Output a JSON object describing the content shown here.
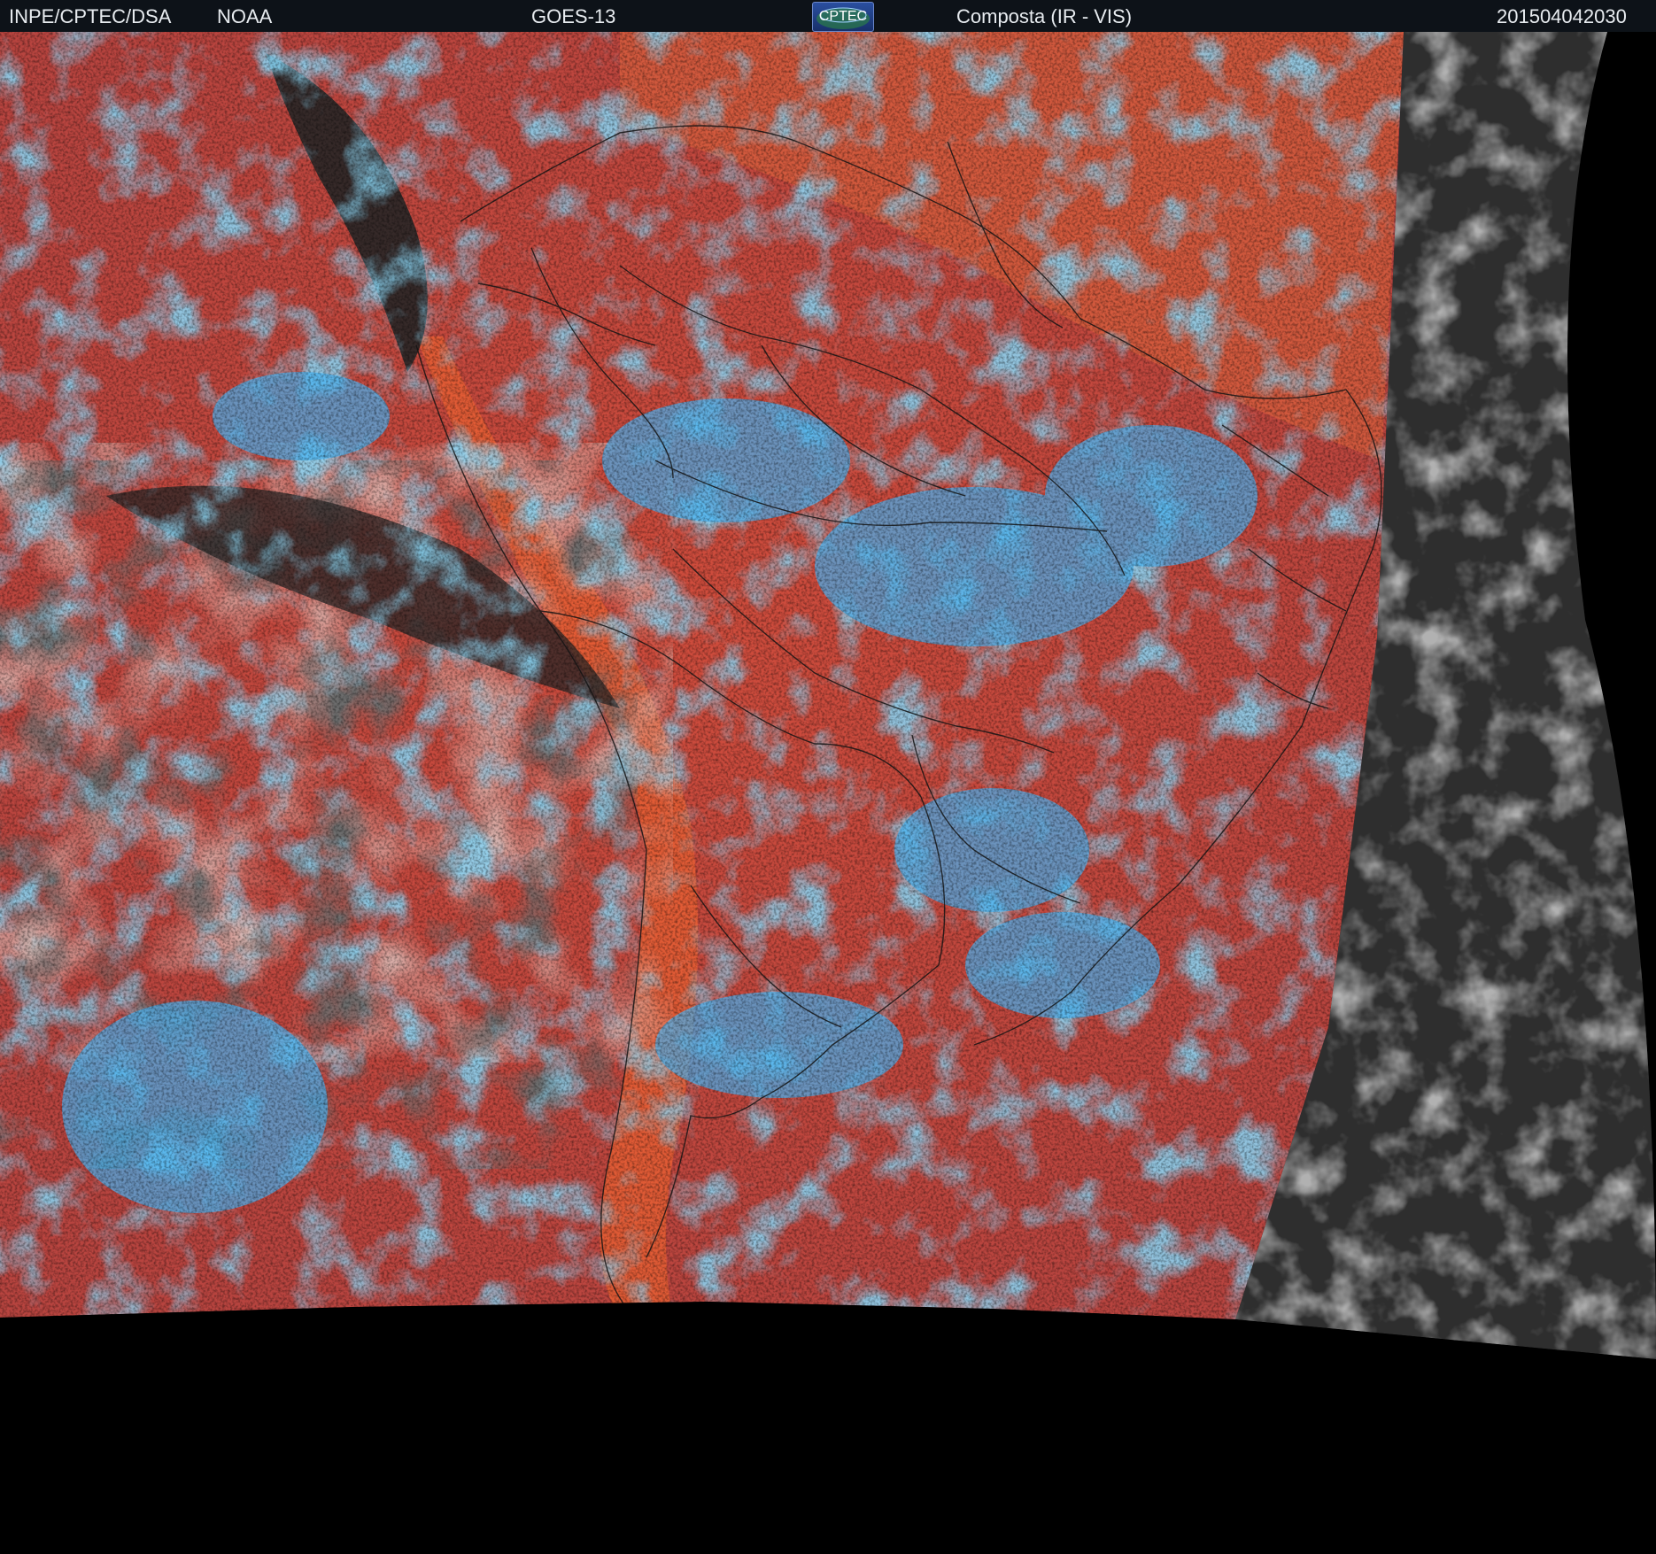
{
  "header": {
    "institution": "INPE/CPTEC/DSA",
    "agency": "NOAA",
    "satellite": "GOES-13",
    "logo_text": "CPTEC",
    "product": "Composta (IR - VIS)",
    "timestamp": "201504042030"
  },
  "colors": {
    "header_bg": "#0d1218",
    "composite_red": "#c44a3e",
    "composite_orange": "#e5623a",
    "cloud_blue": "#3fb0f0",
    "clear_ocean": "#262626",
    "night_gray": "#4a4a4a",
    "space": "#000000",
    "borders": "#111111"
  }
}
